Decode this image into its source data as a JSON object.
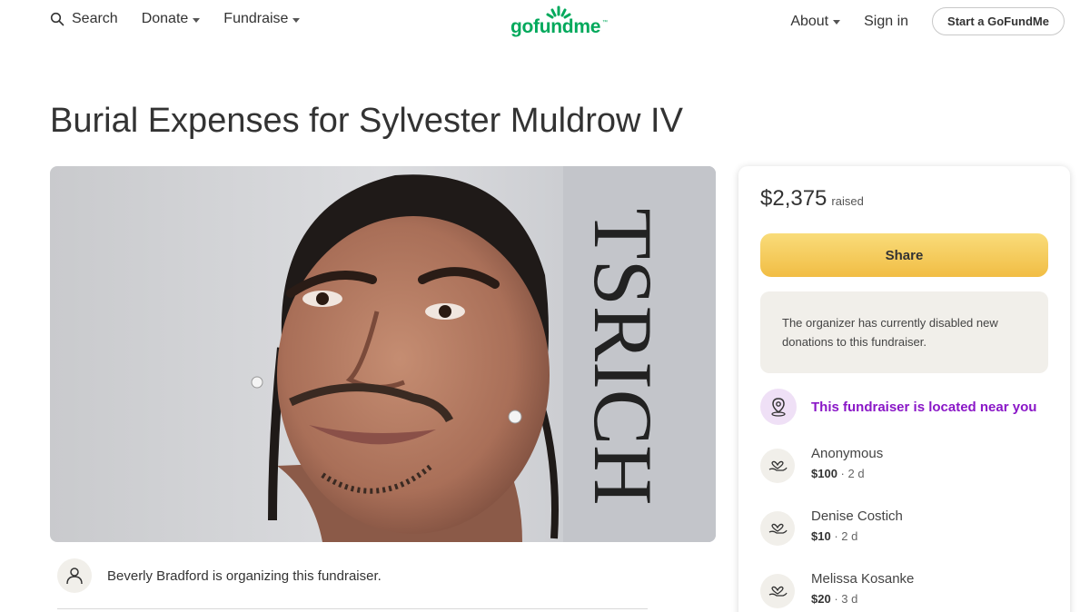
{
  "header": {
    "search_label": "Search",
    "donate_label": "Donate",
    "fundraise_label": "Fundraise",
    "logo_text": "gofundme",
    "logo_tm": "™",
    "about_label": "About",
    "signin_label": "Sign in",
    "start_label": "Start a GoFundMe"
  },
  "page": {
    "title": "Burial Expenses for Sylvester Muldrow IV",
    "image_sign_text": "TSRICH"
  },
  "organizer": {
    "text": "Beverly Bradford is organizing this fundraiser."
  },
  "sidebar": {
    "raised_amount": "$2,375",
    "raised_label": "raised",
    "share_label": "Share",
    "notice": "The organizer has currently disabled new donations to this fundraiser.",
    "nearby_label": "This fundraiser is located near you",
    "donations": [
      {
        "name": "Anonymous",
        "amount": "$100",
        "time": "2 d"
      },
      {
        "name": "Denise Costich",
        "amount": "$10",
        "time": "2 d"
      },
      {
        "name": "Melissa Kosanke",
        "amount": "$20",
        "time": "3 d"
      }
    ]
  },
  "colors": {
    "brand_green": "#02a95c",
    "share_yellow": "#f1bd44",
    "nearby_purple": "#8a17c7",
    "notice_bg": "#f1efea"
  }
}
